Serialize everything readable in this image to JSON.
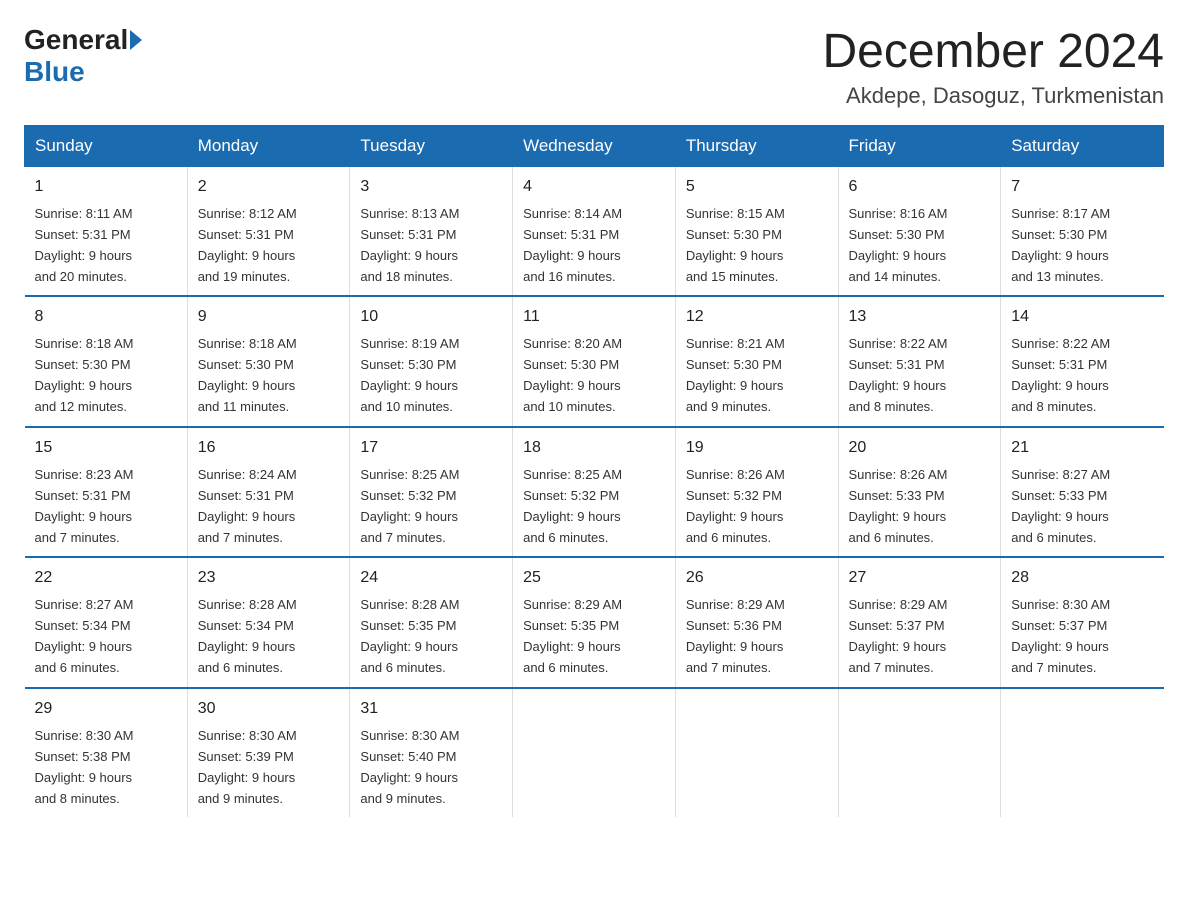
{
  "logo": {
    "general": "General",
    "blue": "Blue"
  },
  "title": "December 2024",
  "subtitle": "Akdepe, Dasoguz, Turkmenistan",
  "days_of_week": [
    "Sunday",
    "Monday",
    "Tuesday",
    "Wednesday",
    "Thursday",
    "Friday",
    "Saturday"
  ],
  "weeks": [
    [
      {
        "day": "1",
        "sunrise": "8:11 AM",
        "sunset": "5:31 PM",
        "daylight": "9 hours and 20 minutes."
      },
      {
        "day": "2",
        "sunrise": "8:12 AM",
        "sunset": "5:31 PM",
        "daylight": "9 hours and 19 minutes."
      },
      {
        "day": "3",
        "sunrise": "8:13 AM",
        "sunset": "5:31 PM",
        "daylight": "9 hours and 18 minutes."
      },
      {
        "day": "4",
        "sunrise": "8:14 AM",
        "sunset": "5:31 PM",
        "daylight": "9 hours and 16 minutes."
      },
      {
        "day": "5",
        "sunrise": "8:15 AM",
        "sunset": "5:30 PM",
        "daylight": "9 hours and 15 minutes."
      },
      {
        "day": "6",
        "sunrise": "8:16 AM",
        "sunset": "5:30 PM",
        "daylight": "9 hours and 14 minutes."
      },
      {
        "day": "7",
        "sunrise": "8:17 AM",
        "sunset": "5:30 PM",
        "daylight": "9 hours and 13 minutes."
      }
    ],
    [
      {
        "day": "8",
        "sunrise": "8:18 AM",
        "sunset": "5:30 PM",
        "daylight": "9 hours and 12 minutes."
      },
      {
        "day": "9",
        "sunrise": "8:18 AM",
        "sunset": "5:30 PM",
        "daylight": "9 hours and 11 minutes."
      },
      {
        "day": "10",
        "sunrise": "8:19 AM",
        "sunset": "5:30 PM",
        "daylight": "9 hours and 10 minutes."
      },
      {
        "day": "11",
        "sunrise": "8:20 AM",
        "sunset": "5:30 PM",
        "daylight": "9 hours and 10 minutes."
      },
      {
        "day": "12",
        "sunrise": "8:21 AM",
        "sunset": "5:30 PM",
        "daylight": "9 hours and 9 minutes."
      },
      {
        "day": "13",
        "sunrise": "8:22 AM",
        "sunset": "5:31 PM",
        "daylight": "9 hours and 8 minutes."
      },
      {
        "day": "14",
        "sunrise": "8:22 AM",
        "sunset": "5:31 PM",
        "daylight": "9 hours and 8 minutes."
      }
    ],
    [
      {
        "day": "15",
        "sunrise": "8:23 AM",
        "sunset": "5:31 PM",
        "daylight": "9 hours and 7 minutes."
      },
      {
        "day": "16",
        "sunrise": "8:24 AM",
        "sunset": "5:31 PM",
        "daylight": "9 hours and 7 minutes."
      },
      {
        "day": "17",
        "sunrise": "8:25 AM",
        "sunset": "5:32 PM",
        "daylight": "9 hours and 7 minutes."
      },
      {
        "day": "18",
        "sunrise": "8:25 AM",
        "sunset": "5:32 PM",
        "daylight": "9 hours and 6 minutes."
      },
      {
        "day": "19",
        "sunrise": "8:26 AM",
        "sunset": "5:32 PM",
        "daylight": "9 hours and 6 minutes."
      },
      {
        "day": "20",
        "sunrise": "8:26 AM",
        "sunset": "5:33 PM",
        "daylight": "9 hours and 6 minutes."
      },
      {
        "day": "21",
        "sunrise": "8:27 AM",
        "sunset": "5:33 PM",
        "daylight": "9 hours and 6 minutes."
      }
    ],
    [
      {
        "day": "22",
        "sunrise": "8:27 AM",
        "sunset": "5:34 PM",
        "daylight": "9 hours and 6 minutes."
      },
      {
        "day": "23",
        "sunrise": "8:28 AM",
        "sunset": "5:34 PM",
        "daylight": "9 hours and 6 minutes."
      },
      {
        "day": "24",
        "sunrise": "8:28 AM",
        "sunset": "5:35 PM",
        "daylight": "9 hours and 6 minutes."
      },
      {
        "day": "25",
        "sunrise": "8:29 AM",
        "sunset": "5:35 PM",
        "daylight": "9 hours and 6 minutes."
      },
      {
        "day": "26",
        "sunrise": "8:29 AM",
        "sunset": "5:36 PM",
        "daylight": "9 hours and 7 minutes."
      },
      {
        "day": "27",
        "sunrise": "8:29 AM",
        "sunset": "5:37 PM",
        "daylight": "9 hours and 7 minutes."
      },
      {
        "day": "28",
        "sunrise": "8:30 AM",
        "sunset": "5:37 PM",
        "daylight": "9 hours and 7 minutes."
      }
    ],
    [
      {
        "day": "29",
        "sunrise": "8:30 AM",
        "sunset": "5:38 PM",
        "daylight": "9 hours and 8 minutes."
      },
      {
        "day": "30",
        "sunrise": "8:30 AM",
        "sunset": "5:39 PM",
        "daylight": "9 hours and 9 minutes."
      },
      {
        "day": "31",
        "sunrise": "8:30 AM",
        "sunset": "5:40 PM",
        "daylight": "9 hours and 9 minutes."
      },
      null,
      null,
      null,
      null
    ]
  ],
  "labels": {
    "sunrise": "Sunrise:",
    "sunset": "Sunset:",
    "daylight": "Daylight:"
  }
}
